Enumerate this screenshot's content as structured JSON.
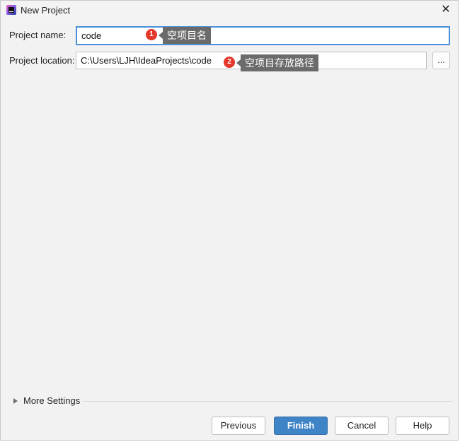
{
  "window": {
    "title": "New Project",
    "close_glyph": "✕",
    "app_icon": "intellij-idea-icon"
  },
  "form": {
    "name_label": "Project name:",
    "name_value": "code",
    "location_label": "Project location:",
    "location_value": "C:\\Users\\LJH\\IdeaProjects\\code",
    "browse_label": "..."
  },
  "annotations": [
    {
      "number": "1",
      "text": "空项目名"
    },
    {
      "number": "2",
      "text": "空项目存放路径"
    }
  ],
  "more_settings": {
    "label": "More Settings"
  },
  "buttons": {
    "previous": "Previous",
    "finish": "Finish",
    "cancel": "Cancel",
    "help": "Help"
  },
  "colors": {
    "primary_button": "#3f84c6",
    "focus_border": "#4a90d9",
    "badge": "#e5382b",
    "tooltip_bg": "#6b6b6b"
  }
}
